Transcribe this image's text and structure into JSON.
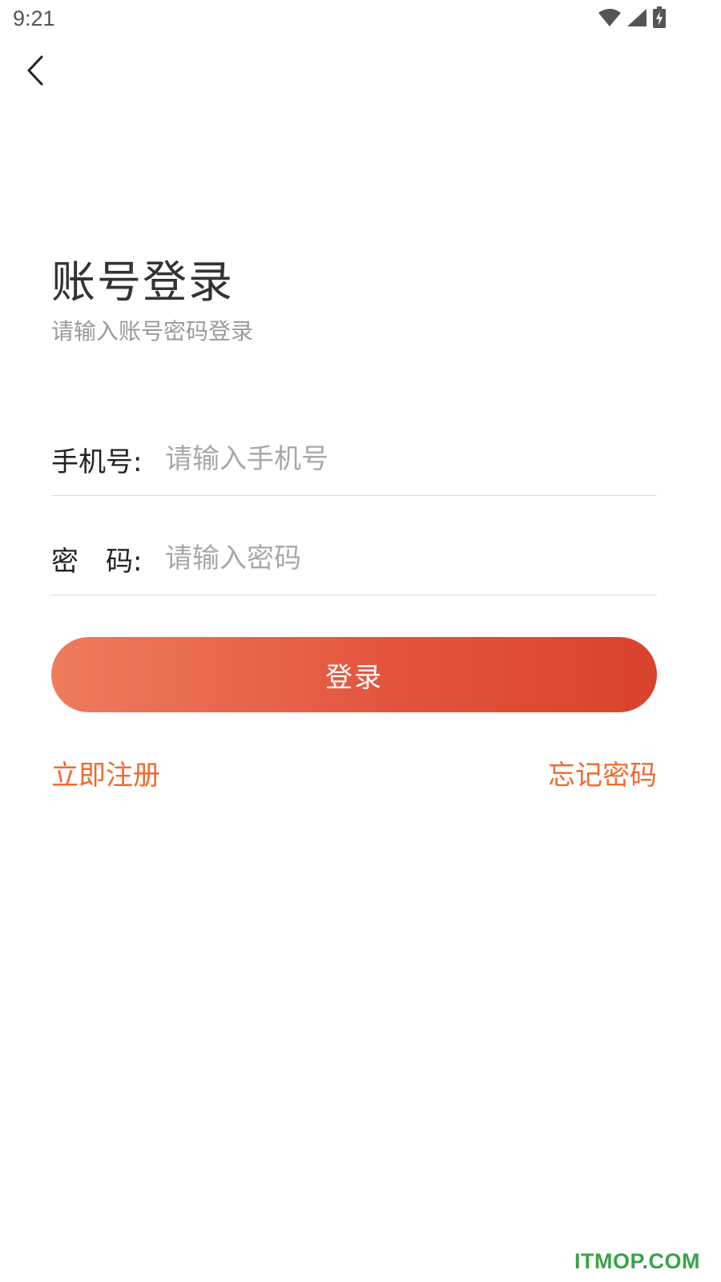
{
  "status_bar": {
    "time": "9:21",
    "icons": [
      "wifi-icon",
      "signal-icon",
      "battery-charging-icon"
    ],
    "icon_color": "#555555"
  },
  "nav": {
    "back_icon": "chevron-left-icon"
  },
  "header": {
    "title": "账号登录",
    "subtitle": "请输入账号密码登录"
  },
  "form": {
    "phone_label": "手机号:",
    "phone_placeholder": "请输入手机号",
    "phone_value": "",
    "password_label": "密　码:",
    "password_placeholder": "请输入密码",
    "password_value": ""
  },
  "actions": {
    "login_label": "登录",
    "register_label": "立即注册",
    "forgot_label": "忘记密码"
  },
  "colors": {
    "accent": "#f06a2e",
    "button_gradient_start": "#ee7c5d",
    "button_gradient_end": "#d9422c",
    "watermark": "#3aa24a"
  },
  "watermark": "ITMOP.COM"
}
